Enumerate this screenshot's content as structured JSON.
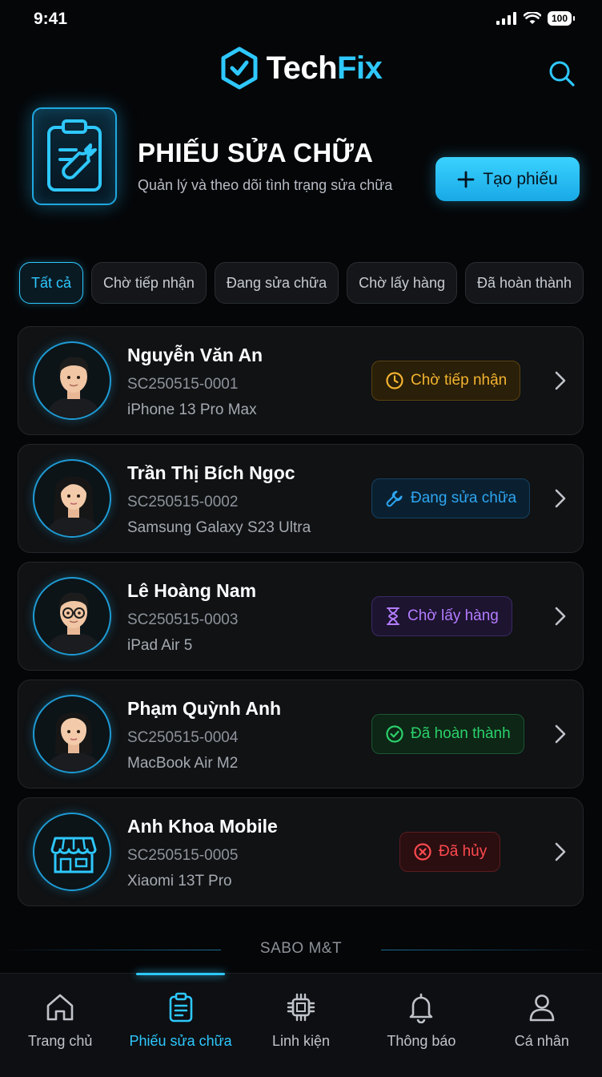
{
  "status_bar": {
    "time": "9:41",
    "battery": "100"
  },
  "header": {
    "logo_part1": "Tech",
    "logo_part2": "Fix"
  },
  "hero": {
    "title": "PHIẾU SỬA CHỮA",
    "subtitle": "Quản lý và theo dõi tình trạng sửa chữa",
    "create_label": "Tạo phiếu"
  },
  "filters": [
    "Tất cả",
    "Chờ tiếp nhận",
    "Đang sửa chữa",
    "Chờ lấy hàng",
    "Đã hoàn thành"
  ],
  "tickets": [
    {
      "name": "Nguyễn Văn An",
      "code": "SC250515-0001",
      "device": "iPhone 13 Pro Max",
      "status": "Chờ tiếp nhận"
    },
    {
      "name": "Trần Thị Bích Ngọc",
      "code": "SC250515-0002",
      "device": "Samsung Galaxy S23 Ultra",
      "status": "Đang sửa chữa"
    },
    {
      "name": "Lê Hoàng Nam",
      "code": "SC250515-0003",
      "device": "iPad Air 5",
      "status": "Chờ lấy hàng"
    },
    {
      "name": "Phạm Quỳnh Anh",
      "code": "SC250515-0004",
      "device": "MacBook Air M2",
      "status": "Đã hoàn thành"
    },
    {
      "name": "Anh Khoa Mobile",
      "code": "SC250515-0005",
      "device": "Xiaomi 13T Pro",
      "status": "Đã hủy"
    }
  ],
  "footer": {
    "brand": "SABO M&T"
  },
  "nav": [
    "Trang chủ",
    "Phiếu sửa chữa",
    "Linh kiện",
    "Thông báo",
    "Cá nhân"
  ],
  "colors": {
    "accent": "#2ec8ff",
    "background": "#050608"
  }
}
